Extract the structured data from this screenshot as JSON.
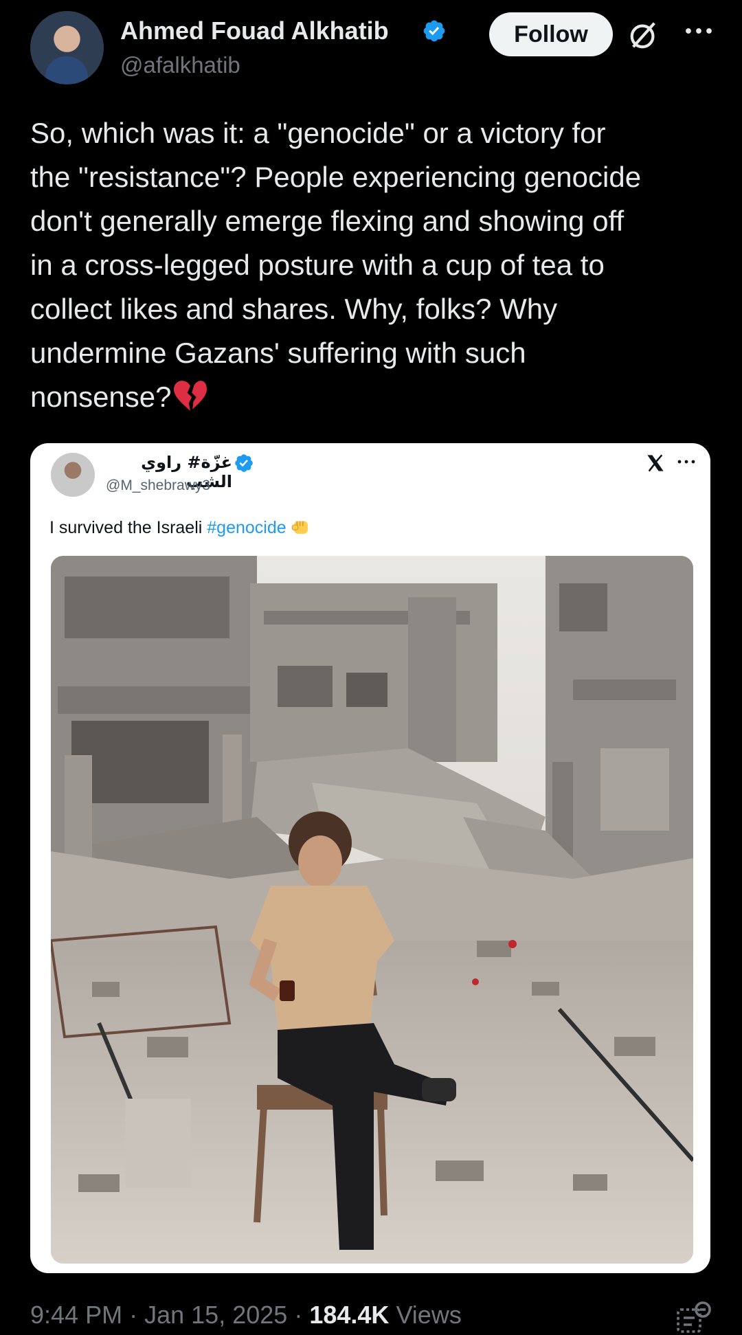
{
  "tweet": {
    "author_name": "Ahmed Fouad Alkhatib",
    "author_handle": "@afalkhatib",
    "follow_label": "Follow",
    "text": "So, which was it: a \"genocide\" or a victory for\nthe \"resistance\"? People experiencing genocide\ndon't generally emerge flexing and showing off\nin a cross-legged posture with a cup of tea to\ncollect likes and shares. Why, folks? Why\nundermine Gazans' suffering with such\nnonsense?",
    "emoji": "broken-heart",
    "time": "9:44 PM",
    "separator": "·",
    "date": "Jan 15, 2025",
    "views_count": "184.4K",
    "views_label": "Views"
  },
  "embedded_tweet": {
    "author_name": "غزّة# راوي الشب",
    "author_handle": "@M_shebrawy3",
    "text_prefix": "I survived the Israeli ",
    "hashtag": "#genocide",
    "emoji": "raised-fist"
  },
  "icons": {
    "verified": "verified-badge-icon",
    "grok": "grok-icon",
    "more": "more-options-icon",
    "x_logo": "x-logo-icon",
    "analytics": "analytics-icon"
  },
  "colors": {
    "background": "#000000",
    "text_primary": "#e7e9ea",
    "text_secondary": "#71767b",
    "verified_blue": "#1d9bf0",
    "follow_button_bg": "#eff3f4",
    "hashtag_blue": "#1d9bf0"
  }
}
